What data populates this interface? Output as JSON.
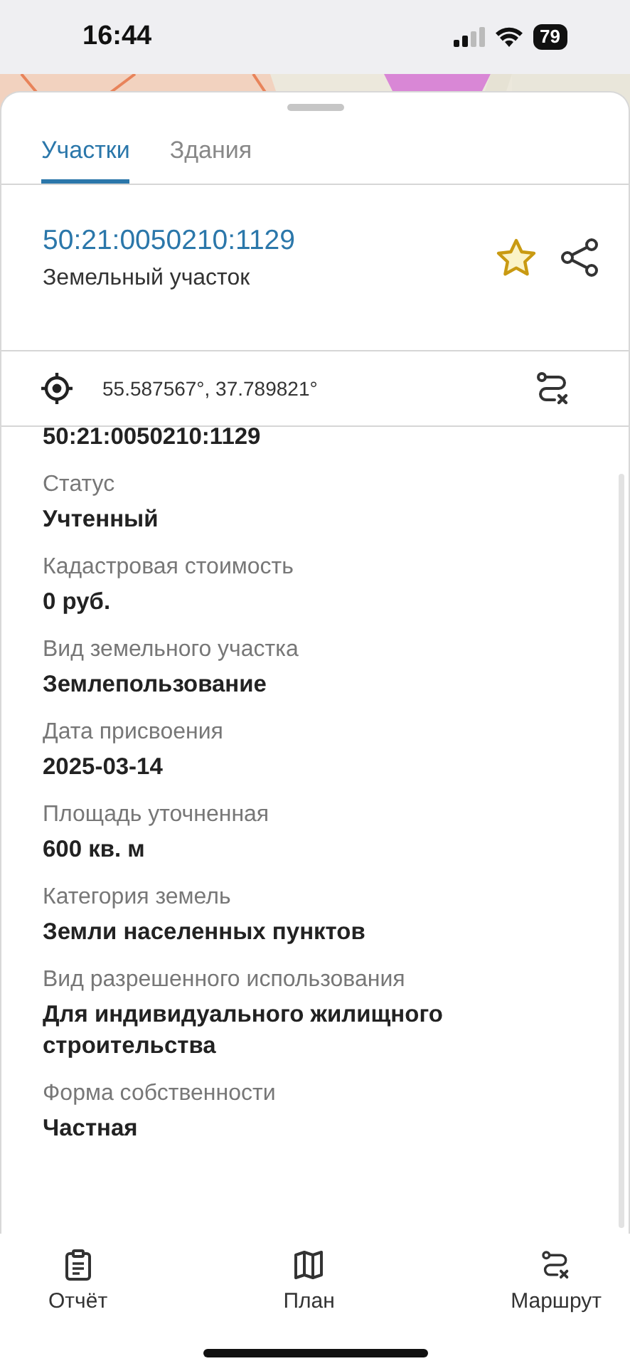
{
  "status_bar": {
    "time": "16:44",
    "battery": "79"
  },
  "tabs": [
    {
      "label": "Участки",
      "selected": true
    },
    {
      "label": "Здания",
      "selected": false
    }
  ],
  "parcel": {
    "number": "50:21:0050210:1129",
    "type": "Земельный участок"
  },
  "location": {
    "coordinates": "55.587567°, 37.789821°"
  },
  "details": [
    {
      "value": "50:21:0050210:1129"
    },
    {
      "label": "Статус",
      "value": "Учтенный"
    },
    {
      "label": "Кадастровая стоимость",
      "value": "0 руб."
    },
    {
      "label": "Вид земельного участка",
      "value": "Землепользование"
    },
    {
      "label": "Дата присвоения",
      "value": "2025-03-14"
    },
    {
      "label": "Площадь уточненная",
      "value": "600 кв. м"
    },
    {
      "label": "Категория земель",
      "value": "Земли населенных пунктов"
    },
    {
      "label": "Вид разрешенного использования",
      "value": "Для индивидуального жилищного строительства"
    },
    {
      "label": "Форма собственности",
      "value": "Частная"
    }
  ],
  "bottom_nav": [
    {
      "label": "Отчёт",
      "kind": "report"
    },
    {
      "label": "План",
      "kind": "map"
    },
    {
      "label": "Маршрут",
      "kind": "route"
    }
  ]
}
